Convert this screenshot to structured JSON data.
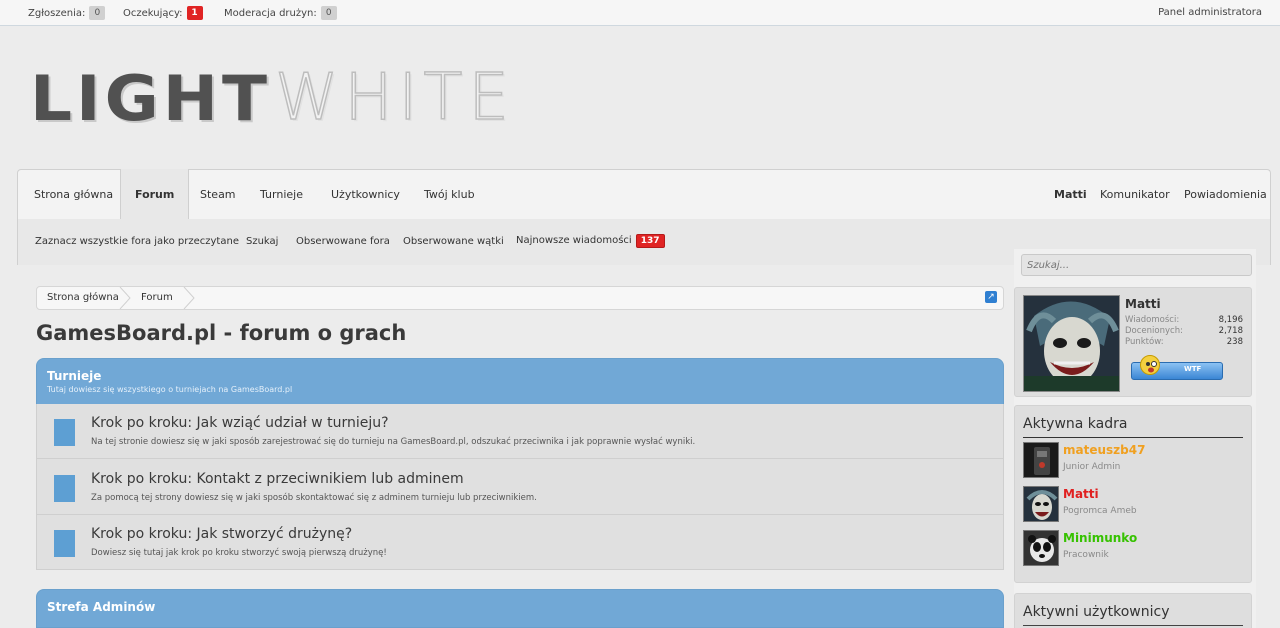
{
  "adminbar": {
    "reports_label": "Zgłoszenia:",
    "reports_count": "0",
    "pending_label": "Oczekujący:",
    "pending_count": "1",
    "team_mod_label": "Moderacja drużyn:",
    "team_mod_count": "0",
    "admin_panel": "Panel administratora"
  },
  "logo": {
    "part1": "LIGHT",
    "part2": "WHITE"
  },
  "nav": {
    "tabs": [
      "Strona główna",
      "Forum",
      "Steam",
      "Turnieje",
      "Użytkownicy",
      "Twój klub"
    ],
    "active_tab": "Forum",
    "user": "Matti",
    "messenger": "Komunikator",
    "notifications": "Powiadomienia"
  },
  "subnav": {
    "mark_read": "Zaznacz wszystkie fora jako przeczytane",
    "search": "Szukaj",
    "watched_forums": "Obserwowane fora",
    "watched_threads": "Obserwowane wątki",
    "newest_posts": "Najnowsze wiadomości",
    "newest_count": "137"
  },
  "breadcrumb": {
    "home": "Strona główna",
    "current": "Forum"
  },
  "page": {
    "title": "GamesBoard.pl - forum o grach"
  },
  "categories": [
    {
      "title": "Turnieje",
      "description": "Tutaj dowiesz się wszystkiego o turniejach na GamesBoard.pl",
      "forums": [
        {
          "title": "Krok po kroku: Jak wziąć udział w turnieju?",
          "description": "Na tej stronie dowiesz się w jaki sposób zarejestrować się do turnieju na GamesBoard.pl, odszukać przeciwnika i jak poprawnie wysłać wyniki."
        },
        {
          "title": "Krok po kroku: Kontakt z przeciwnikiem lub adminem",
          "description": "Za pomocą tej strony dowiesz się w jaki sposób skontaktować się z adminem turnieju lub przeciwnikiem."
        },
        {
          "title": "Krok po kroku: Jak stworzyć drużynę?",
          "description": "Dowiesz się tutaj jak krok po kroku stworzyć swoją pierwszą drużynę!"
        }
      ]
    },
    {
      "title": "Strefa Adminów"
    }
  ],
  "sidebar": {
    "search_placeholder": "Szukaj...",
    "profile": {
      "name": "Matti",
      "stats": [
        {
          "label": "Wiadomości:",
          "value": "8,196"
        },
        {
          "label": "Docenionych:",
          "value": "2,718"
        },
        {
          "label": "Punktów:",
          "value": "238"
        }
      ],
      "wtf_label": "WTF"
    },
    "staff": {
      "heading": "Aktywna kadra",
      "members": [
        {
          "name": "mateuszb47",
          "role": "Junior Admin",
          "color": "#f0a020"
        },
        {
          "name": "Matti",
          "role": "Pogromca Ameb",
          "color": "#e02020"
        },
        {
          "name": "Minimunko",
          "role": "Pracownik",
          "color": "#36c200"
        }
      ]
    },
    "active_users": {
      "heading": "Aktywni użytkownicy"
    }
  },
  "colors": {
    "category_header": "#71a8d6",
    "forum_icon": "#5d9fd3",
    "badge_red": "#e02424"
  }
}
